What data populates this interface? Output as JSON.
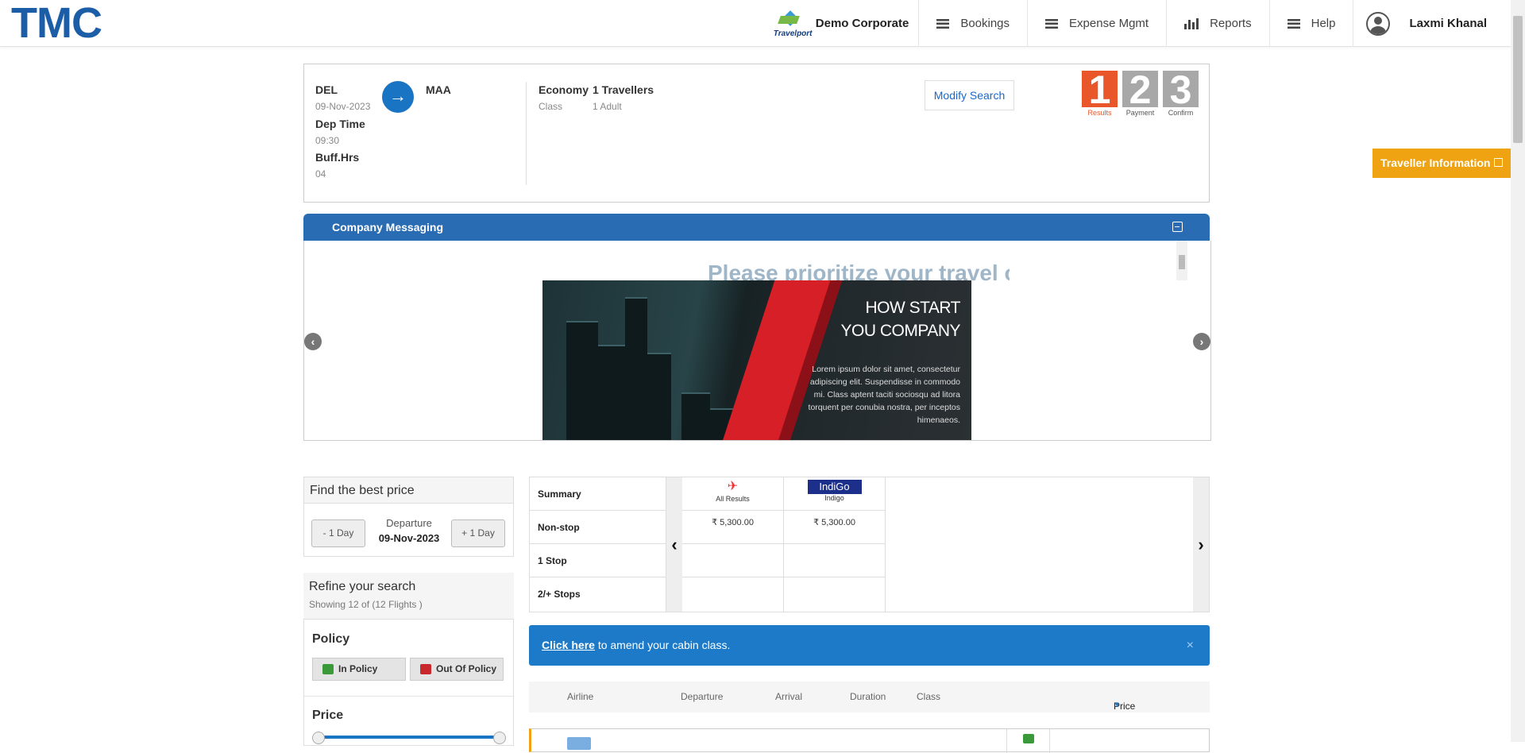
{
  "header": {
    "logo": "TMC",
    "travelport": "Travelport",
    "company": "Demo Corporate",
    "nav": [
      "Bookings",
      "Expense Mgmt",
      "Reports",
      "Help"
    ],
    "user": "Laxmi Khanal"
  },
  "search": {
    "from": "DEL",
    "date": "09-Nov-2023",
    "to": "MAA",
    "dep_time_label": "Dep Time",
    "dep_time": "09:30",
    "buff_label": "Buff.Hrs",
    "buff": "04",
    "cabin": "Economy",
    "cabin_sub": "Class",
    "travellers": "1 Travellers",
    "travellers_sub": "1 Adult",
    "modify": "Modify Search"
  },
  "steps": [
    {
      "num": "1",
      "label": "Results",
      "active": true
    },
    {
      "num": "2",
      "label": "Payment",
      "active": false
    },
    {
      "num": "3",
      "label": "Confirm",
      "active": false
    }
  ],
  "traveller_info": "Traveller Information",
  "messaging": {
    "title": "Company Messaging",
    "marquee": "Please prioritize your travel only on weekdays",
    "banner_title_1": "HOW START",
    "banner_title_2": "YOU COMPANY",
    "banner_text": "Lorem ipsum dolor sit amet, consectetur adipiscing elit. Suspendisse in commodo mi. Class aptent taciti sociosqu ad litora torquent per conubia nostra, per inceptos himenaeos."
  },
  "best_price": {
    "title": "Find the best price",
    "minus": "- 1 Day",
    "plus": "+ 1 Day",
    "dep_label": "Departure",
    "dep_date": "09-Nov-2023"
  },
  "refine": {
    "title": "Refine your search",
    "showing": "Showing 12 of (12 Flights )",
    "policy": "Policy",
    "in_policy": "In Policy",
    "out_policy": "Out Of Policy",
    "price": "Price"
  },
  "matrix": {
    "rows": [
      "Summary",
      "Non-stop",
      "1 Stop",
      "2/+ Stops"
    ],
    "columns": [
      {
        "name": "All Results",
        "nonstop": "₹ 5,300.00"
      },
      {
        "name": "Indigo",
        "logo": "IndiGo",
        "nonstop": "₹ 5,300.00"
      }
    ]
  },
  "amend": {
    "link": "Click here",
    "text": " to amend your cabin class.",
    "close": "×"
  },
  "result_header": [
    "Airline",
    "Departure",
    "Arrival",
    "Duration",
    "Class",
    "Price"
  ]
}
